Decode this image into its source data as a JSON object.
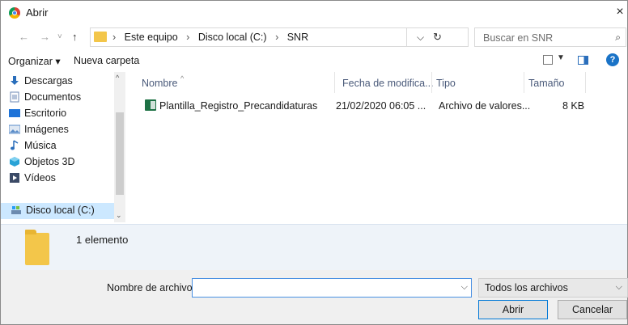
{
  "window": {
    "title": "Abrir",
    "close": "×"
  },
  "nav": {
    "back": "←",
    "forward": "→",
    "recent": "˅",
    "up": "↑"
  },
  "address": {
    "crumbs": [
      "Este equipo",
      "Disco local (C:)",
      "SNR"
    ],
    "sep": "›"
  },
  "address_tools": {
    "dropdown": "⌵",
    "refresh": "↻"
  },
  "search": {
    "placeholder": "Buscar en SNR",
    "icon": "⌕"
  },
  "toolbar": {
    "organize": "Organizar ▾",
    "new_folder": "Nueva carpeta",
    "view_dd": "▼",
    "help": "?"
  },
  "sidebar": {
    "items": [
      {
        "label": "Descargas",
        "icon": "download-icon",
        "color": "#2a6ebb"
      },
      {
        "label": "Documentos",
        "icon": "document-icon",
        "color": "#6c8ab5"
      },
      {
        "label": "Escritorio",
        "icon": "desktop-icon",
        "color": "#1e73d8"
      },
      {
        "label": "Imágenes",
        "icon": "images-icon",
        "color": "#5b8dc9"
      },
      {
        "label": "Música",
        "icon": "music-icon",
        "color": "#2a6ebb"
      },
      {
        "label": "Objetos 3D",
        "icon": "3d-objects-icon",
        "color": "#29a3d6"
      },
      {
        "label": "Vídeos",
        "icon": "videos-icon",
        "color": "#3b4a66"
      },
      {
        "label": "Disco local (C:)",
        "icon": "drive-icon",
        "color": "#6b8bb0"
      }
    ],
    "scroll_up": "^",
    "scroll_down": "⌄"
  },
  "files": {
    "columns": [
      "Nombre",
      "Fecha de modifica...",
      "Tipo",
      "Tamaño"
    ],
    "sort_indicator": "^",
    "rows": [
      {
        "name": "Plantilla_Registro_Precandidaturas",
        "date": "21/02/2020 06:05 ...",
        "type": "Archivo de valores...",
        "size": "8 KB"
      }
    ]
  },
  "details": {
    "count": "1 elemento"
  },
  "bottom": {
    "filename_label": "Nombre de archivo:",
    "filename_value": "",
    "filename_dd": "⌵",
    "filetype": "Todos los archivos",
    "filetype_dd": "⌵",
    "open": "Abrir",
    "cancel": "Cancelar"
  },
  "colors": {
    "accent": "#0078d7",
    "selected": "#cce8ff",
    "details_bg": "#eef3f9",
    "bottom_bg": "#f0f0f0"
  }
}
